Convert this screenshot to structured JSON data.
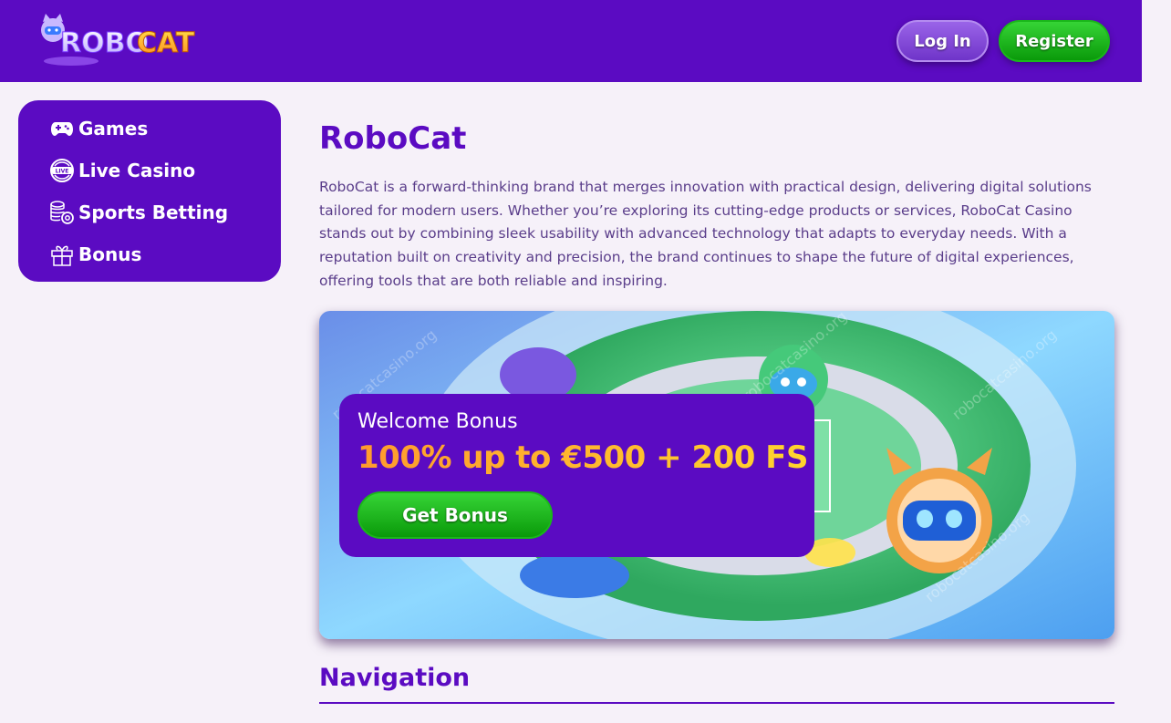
{
  "header": {
    "logo_text": "ROBOCAT",
    "login_label": "Log In",
    "register_label": "Register"
  },
  "sidebar": {
    "items": [
      {
        "label": "Games",
        "icon": "gamepad-icon"
      },
      {
        "label": "Live Casino",
        "icon": "live-icon"
      },
      {
        "label": "Sports Betting",
        "icon": "coins-gear-icon"
      },
      {
        "label": "Bonus",
        "icon": "gift-icon"
      }
    ]
  },
  "main": {
    "title": "RoboCat",
    "description": "RoboCat is a forward-thinking brand that merges innovation with practical design, delivering digital solutions tailored for modern users. Whether you’re exploring its cutting-edge products or services, RoboCat Casino stands out by combining sleek usability with advanced technology that adapts to everyday needs. With a reputation built on creativity and precision, the brand continues to shape the future of digital experiences, offering tools that are both reliable and inspiring.",
    "banner": {
      "subtitle": "Welcome Bonus",
      "offer": "100% up to €500 + 200 FS",
      "button_label": "Get Bonus",
      "watermark": "robocatcasino.org"
    },
    "navigation_heading": "Navigation"
  },
  "colors": {
    "brand_purple": "#5b0bc2",
    "background": "#f6f1f9",
    "green_button": "#1ab81a",
    "offer_gradient_start": "#ff9a2e",
    "offer_gradient_end": "#ffd52e"
  }
}
